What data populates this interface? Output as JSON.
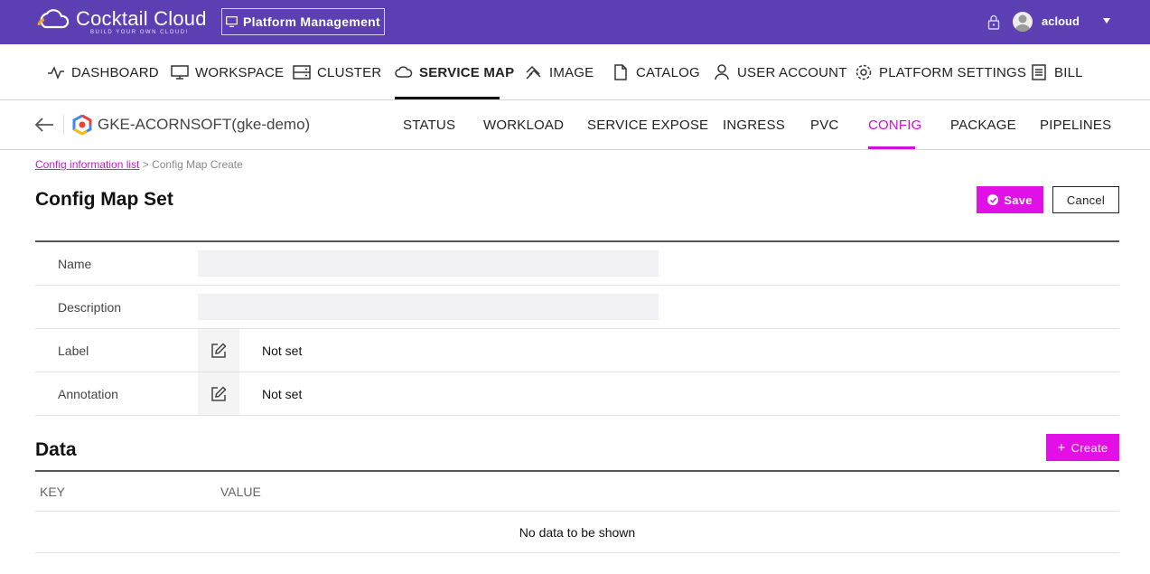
{
  "header": {
    "logo_title": "Cocktail Cloud",
    "logo_subtitle": "BUILD YOUR OWN CLOUD!",
    "platform_button": "Platform Management",
    "username": "acloud",
    "icons": [
      "logo-icon",
      "monitor-icon",
      "lock-icon",
      "avatar",
      "caret-down-icon"
    ]
  },
  "main_nav": {
    "items": [
      {
        "label": "DASHBOARD",
        "icon": "activity-icon"
      },
      {
        "label": "WORKSPACE",
        "icon": "monitor-icon"
      },
      {
        "label": "CLUSTER",
        "icon": "server-icon"
      },
      {
        "label": "SERVICE MAP",
        "icon": "cloud-icon",
        "active": true
      },
      {
        "label": "IMAGE",
        "icon": "image-icon"
      },
      {
        "label": "CATALOG",
        "icon": "file-icon"
      },
      {
        "label": "USER ACCOUNT",
        "icon": "user-icon"
      },
      {
        "label": "PLATFORM SETTINGS",
        "icon": "gear-icon"
      },
      {
        "label": "BILL",
        "icon": "bill-icon"
      }
    ]
  },
  "sub_nav": {
    "cluster_name": "GKE-ACORNSOFT(gke-demo)",
    "items": [
      {
        "label": "STATUS"
      },
      {
        "label": "WORKLOAD"
      },
      {
        "label": "SERVICE EXPOSE"
      },
      {
        "label": "INGRESS"
      },
      {
        "label": "PVC"
      },
      {
        "label": "CONFIG",
        "active": true
      },
      {
        "label": "PACKAGE"
      },
      {
        "label": "PIPELINES"
      }
    ]
  },
  "breadcrumb": {
    "link": "Config information list",
    "separator": ">",
    "current": "Config Map Create"
  },
  "page": {
    "title": "Config Map Set",
    "save_label": "Save",
    "cancel_label": "Cancel"
  },
  "form": {
    "name_label": "Name",
    "name_value": "",
    "description_label": "Description",
    "description_value": "",
    "label_label": "Label",
    "label_value": "Not set",
    "annotation_label": "Annotation",
    "annotation_value": "Not set"
  },
  "data_section": {
    "title": "Data",
    "create_label": "Create",
    "key_header": "KEY",
    "value_header": "VALUE",
    "empty_text": "No data to be shown"
  },
  "colors": {
    "topbar": "#5b3fb3",
    "accent": "#e110e6",
    "active_tab": "#d10ed8"
  }
}
